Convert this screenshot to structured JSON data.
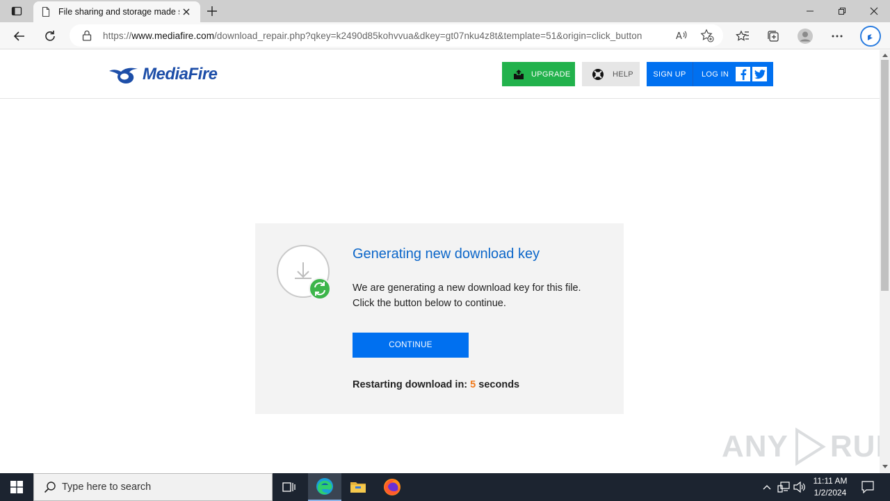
{
  "browser": {
    "tab_title": "File sharing and storage made simple",
    "url_prefix": "https://",
    "url_domain": "www.mediafire.com",
    "url_path": "/download_repair.php?qkey=k2490d85kohvvua&dkey=gt07nku4z8t&template=51&origin=click_button"
  },
  "site": {
    "logo_text": "MediaFire",
    "upgrade_label": "UPGRADE",
    "help_label": "HELP",
    "signup_label": "SIGN UP",
    "login_label": "LOG IN"
  },
  "card": {
    "heading": "Generating new download key",
    "message_line1": "We are generating a new download key for this file.",
    "message_line2": "Click the button below to continue.",
    "continue_label": "CONTINUE",
    "restart_prefix": "Restarting download in:",
    "restart_count": "5",
    "restart_suffix": "seconds"
  },
  "watermark": {
    "text_left": "ANY",
    "text_right": "RUN"
  },
  "taskbar": {
    "search_placeholder": "Type here to search",
    "time": "11:11 AM",
    "date": "1/2/2024"
  },
  "colors": {
    "brand_blue": "#0070f0",
    "upgrade_green": "#22b24c",
    "heading_blue": "#0b66c9",
    "countdown_orange": "#f07a1c"
  }
}
